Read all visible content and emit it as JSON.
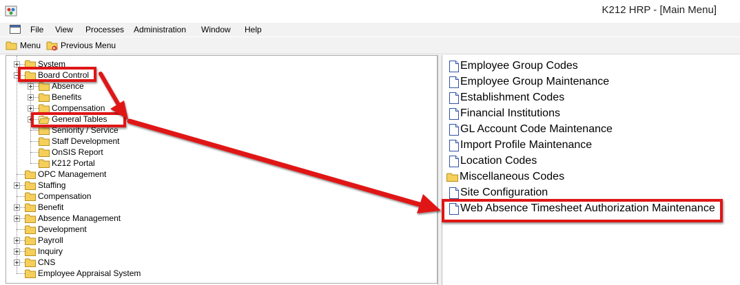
{
  "window": {
    "title": "K212 HRP - [Main Menu]"
  },
  "menubar": {
    "items": [
      "File",
      "View",
      "Processes",
      "Administration",
      "Window",
      "Help"
    ]
  },
  "toolbar": {
    "menu_label": "Menu",
    "previous_menu_label": "Previous Menu"
  },
  "tree": {
    "nodes": [
      {
        "label": "System",
        "expandable": true,
        "expanded": false
      },
      {
        "label": "Board Control",
        "expandable": true,
        "expanded": true,
        "highlighted": true
      },
      {
        "label": "Absence",
        "expandable": true,
        "expanded": false
      },
      {
        "label": "Benefits",
        "expandable": true,
        "expanded": false
      },
      {
        "label": "Compensation",
        "expandable": true,
        "expanded": false
      },
      {
        "label": "General Tables",
        "expandable": true,
        "expanded": false,
        "selected": true,
        "highlighted": true
      },
      {
        "label": "Seniority / Service",
        "expandable": false
      },
      {
        "label": "Staff Development",
        "expandable": false
      },
      {
        "label": "OnSIS Report",
        "expandable": false
      },
      {
        "label": "K212 Portal",
        "expandable": false
      },
      {
        "label": "OPC Management",
        "expandable": false
      },
      {
        "label": "Staffing",
        "expandable": true,
        "expanded": false
      },
      {
        "label": "Compensation",
        "expandable": false
      },
      {
        "label": "Benefit",
        "expandable": true,
        "expanded": false
      },
      {
        "label": "Absence Management",
        "expandable": true,
        "expanded": false
      },
      {
        "label": "Development",
        "expandable": false
      },
      {
        "label": "Payroll",
        "expandable": true,
        "expanded": false
      },
      {
        "label": "Inquiry",
        "expandable": true,
        "expanded": false
      },
      {
        "label": "CNS",
        "expandable": true,
        "expanded": false
      },
      {
        "label": "Employee Appraisal System",
        "expandable": false
      }
    ]
  },
  "list": {
    "items": [
      {
        "label": "Employee Group Codes",
        "icon": "document-icon"
      },
      {
        "label": "Employee Group Maintenance",
        "icon": "document-icon"
      },
      {
        "label": "Establishment Codes",
        "icon": "document-icon"
      },
      {
        "label": "Financial Institutions",
        "icon": "document-icon"
      },
      {
        "label": "GL Account Code Maintenance",
        "icon": "document-icon"
      },
      {
        "label": "Import Profile Maintenance",
        "icon": "document-icon"
      },
      {
        "label": "Location Codes",
        "icon": "document-icon"
      },
      {
        "label": "Miscellaneous Codes",
        "icon": "folder-icon"
      },
      {
        "label": "Site Configuration",
        "icon": "document-icon"
      },
      {
        "label": "Web Absence Timesheet Authorization Maintenance",
        "icon": "document-icon",
        "highlighted": true
      }
    ]
  },
  "colors": {
    "highlight": "#e01616",
    "folder": "#f5cf5a",
    "folder_edge": "#b8901e",
    "document_edge": "#2d52a8"
  }
}
